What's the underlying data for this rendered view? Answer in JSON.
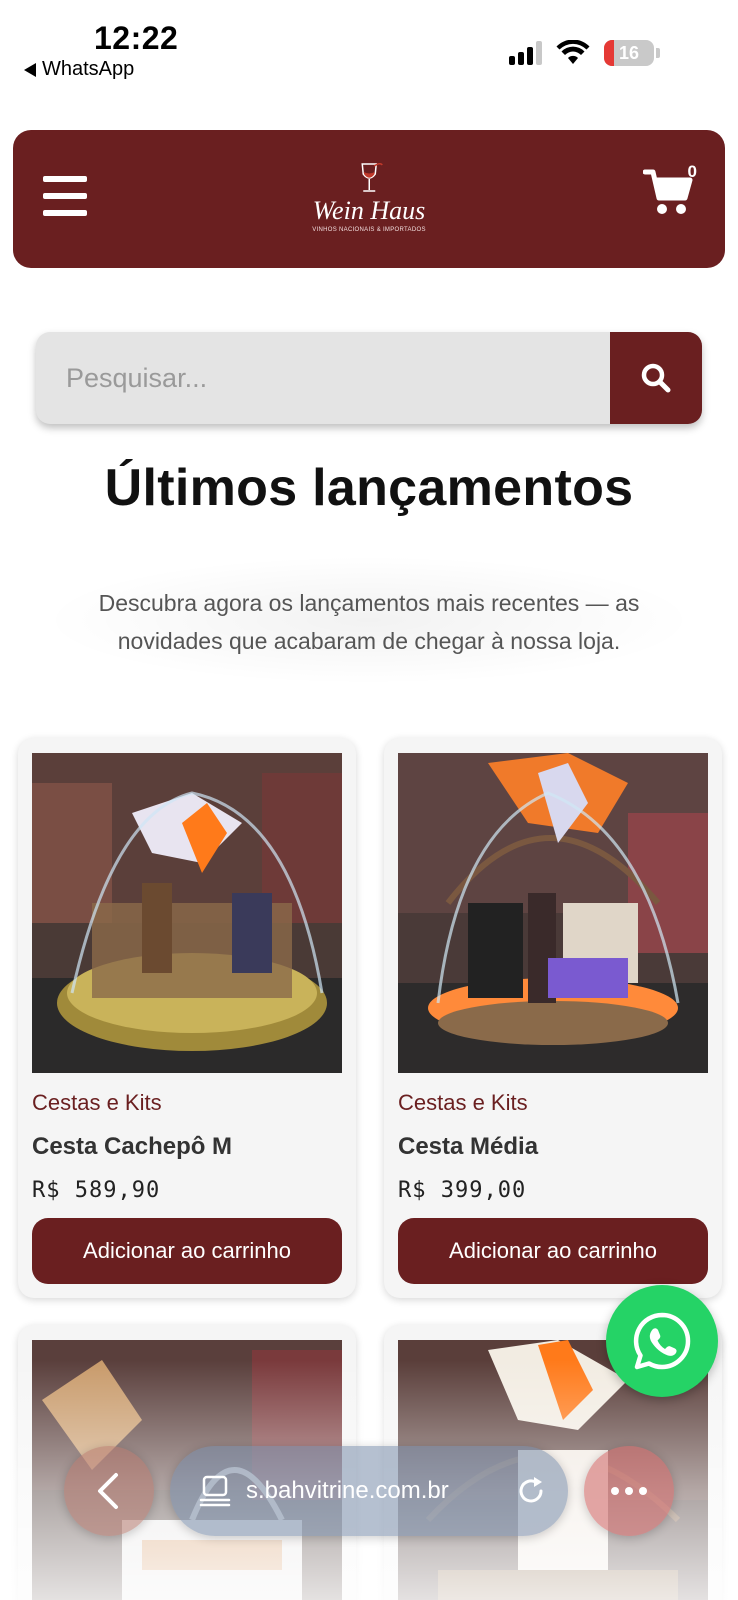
{
  "status_bar": {
    "time": "12:22",
    "back_app": "WhatsApp",
    "battery": "16",
    "icons": [
      "cellular-signal-icon",
      "wifi-icon",
      "battery-icon"
    ]
  },
  "header": {
    "brand_name": "Wein Haus",
    "brand_tagline": "VINHOS NACIONAIS & IMPORTADOS",
    "cart_count": "0",
    "bg_color": "#6a1f20"
  },
  "search": {
    "placeholder": "Pesquisar..."
  },
  "section": {
    "title": "Últimos lançamentos",
    "description": "Descubra agora os lançamentos mais recentes — as novidades que acabaram de chegar à nossa loja."
  },
  "products": [
    {
      "category": "Cestas e Kits",
      "name": "Cesta Cachepô M",
      "price": "R$ 589,90",
      "button": "Adicionar ao carrinho"
    },
    {
      "category": "Cestas e Kits",
      "name": "Cesta Média",
      "price": "R$ 399,00",
      "button": "Adicionar ao carrinho"
    },
    {
      "category": "",
      "name": "",
      "price": "",
      "button": ""
    },
    {
      "category": "",
      "name": "",
      "price": "",
      "button": ""
    }
  ],
  "browser": {
    "url": "s.bahvitrine.com.br"
  },
  "colors": {
    "accent": "#6a1f20",
    "whatsapp": "#25d366"
  }
}
